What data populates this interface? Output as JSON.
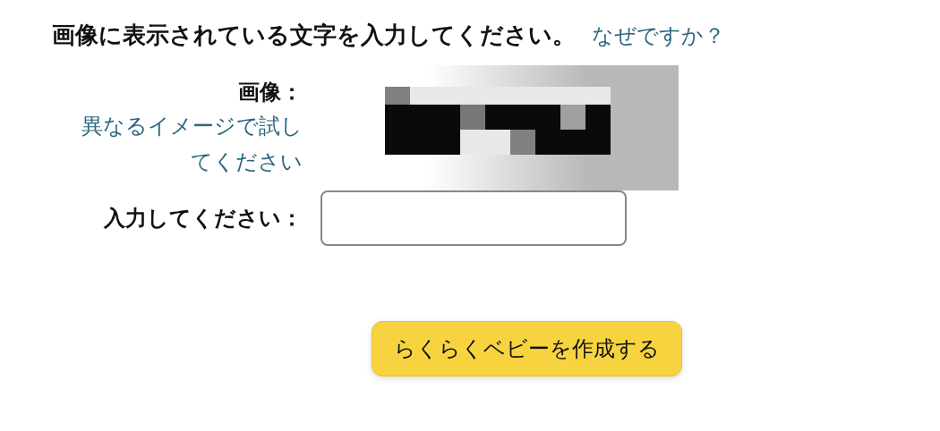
{
  "heading": {
    "text": "画像に表示されている文字を入力してください。",
    "link": "なぜですか？"
  },
  "captcha": {
    "label": "画像：",
    "retry_link": "異なるイメージで試してください"
  },
  "answer": {
    "label": "入力してください："
  },
  "submit_button": "らくらくベビーを作成する"
}
